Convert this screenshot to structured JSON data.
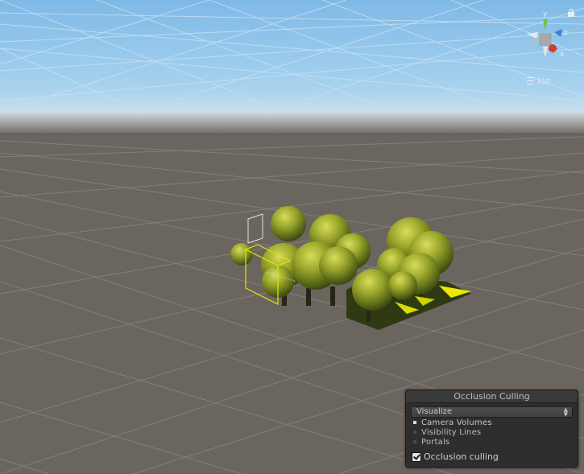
{
  "scene_view": {
    "projection_label": "Iso",
    "gizmo": {
      "y_label": "y",
      "z_label": "z",
      "x_label": "x"
    },
    "colors": {
      "sky": "#8cc3ea",
      "horizon": "#d0dde6",
      "ground": "#6b6560",
      "grid": "#8a8580",
      "foliage": "#8a9a23",
      "selection": "#e6e600"
    }
  },
  "occlusion_panel": {
    "title": "Occlusion Culling",
    "mode_value": "Visualize",
    "items": [
      {
        "label": "Camera Volumes",
        "checked": true
      },
      {
        "label": "Visibility Lines",
        "checked": false
      },
      {
        "label": "Portals",
        "checked": false
      }
    ],
    "toggle_label": "Occlusion culling",
    "toggle_checked": true
  }
}
